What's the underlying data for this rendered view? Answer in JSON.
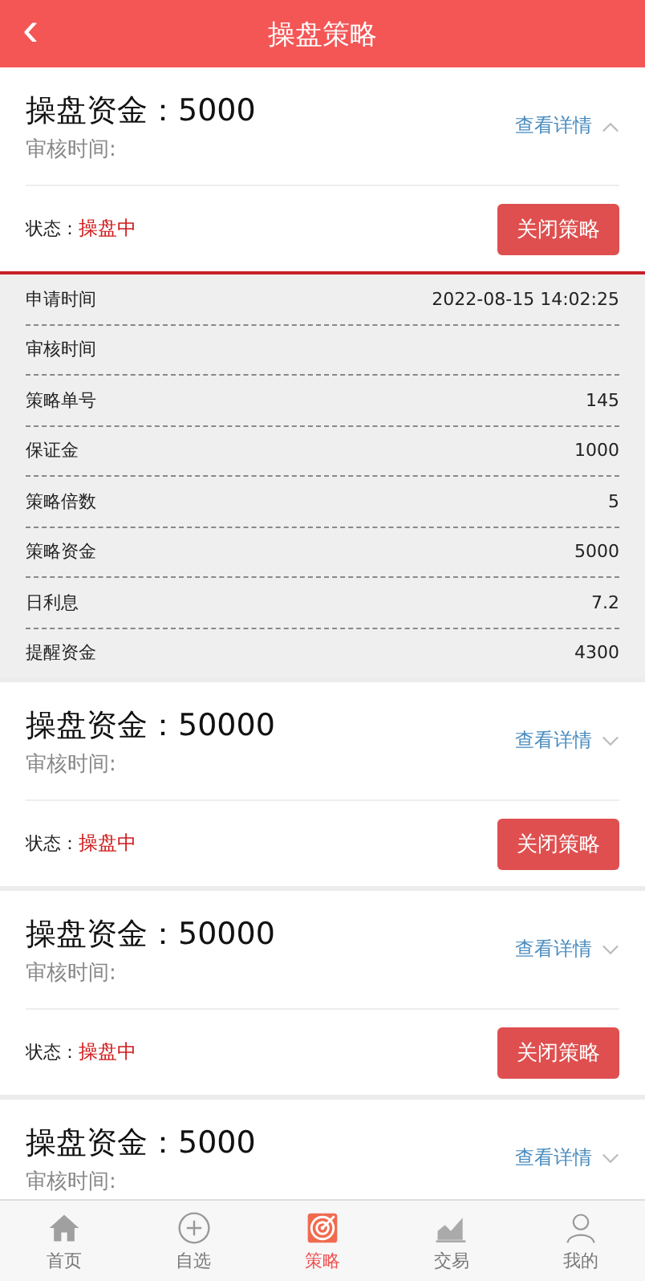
{
  "header": {
    "back": "‹",
    "title": "操盘策略"
  },
  "cards": [
    {
      "title": "操盘资金：5000",
      "audit_label": "审核时间:",
      "link": "查看详情",
      "expanded": true,
      "status_label": "状态：",
      "status": "操盘中",
      "button": "关闭策略",
      "details": [
        {
          "label": "申请时间",
          "value": "2022-08-15 14:02:25"
        },
        {
          "label": "审核时间"
        },
        {
          "label": "策略单号",
          "value": "145"
        },
        {
          "label": "保证金",
          "value": "1000"
        },
        {
          "label": "策略倍数",
          "value": "5"
        },
        {
          "label": "策略资金",
          "value": "5000"
        },
        {
          "label": "日利息",
          "value": "7.2"
        },
        {
          "label": "提醒资金",
          "value": "4300"
        }
      ]
    },
    {
      "title": "操盘资金：50000",
      "audit_label": "审核时间:",
      "link": "查看详情",
      "expanded": false,
      "status_label": "状态：",
      "status": "操盘中",
      "button": "关闭策略"
    },
    {
      "title": "操盘资金：50000",
      "audit_label": "审核时间:",
      "link": "查看详情",
      "expanded": false,
      "status_label": "状态：",
      "status": "操盘中",
      "button": "关闭策略"
    },
    {
      "title": "操盘资金：5000",
      "audit_label": "审核时间:",
      "link": "查看详情",
      "expanded": false
    }
  ],
  "tabbar": [
    {
      "kind": "home",
      "label": "首页",
      "selected": false
    },
    {
      "kind": "plus",
      "label": "自选",
      "selected": false
    },
    {
      "kind": "target",
      "label": "策略",
      "selected": true
    },
    {
      "kind": "chart",
      "label": "交易",
      "selected": false
    },
    {
      "kind": "user",
      "label": "我的",
      "selected": false
    }
  ]
}
